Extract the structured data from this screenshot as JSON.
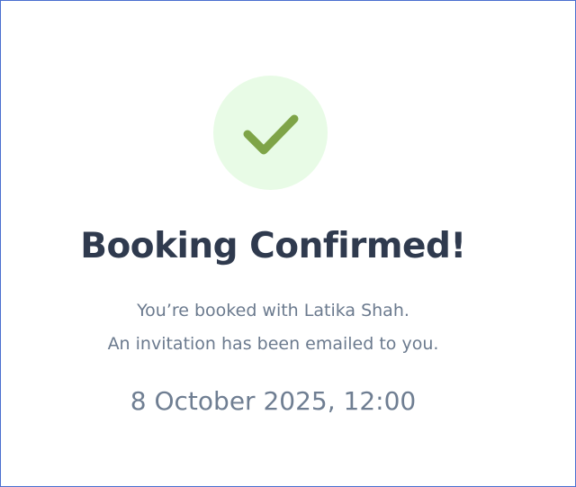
{
  "confirmation": {
    "title": "Booking Confirmed!",
    "message_line_1": "You’re booked with Latika Shah.",
    "message_line_2": "An invitation has been emailed to you.",
    "datetime": "8 October 2025, 12:00",
    "icon": "checkmark-icon"
  },
  "colors": {
    "success_circle": "#e8fbe6",
    "checkmark": "#7ea447",
    "title": "#2f3a4e",
    "text": "#6b7a8e",
    "frame_border": "#4a6fd0"
  }
}
